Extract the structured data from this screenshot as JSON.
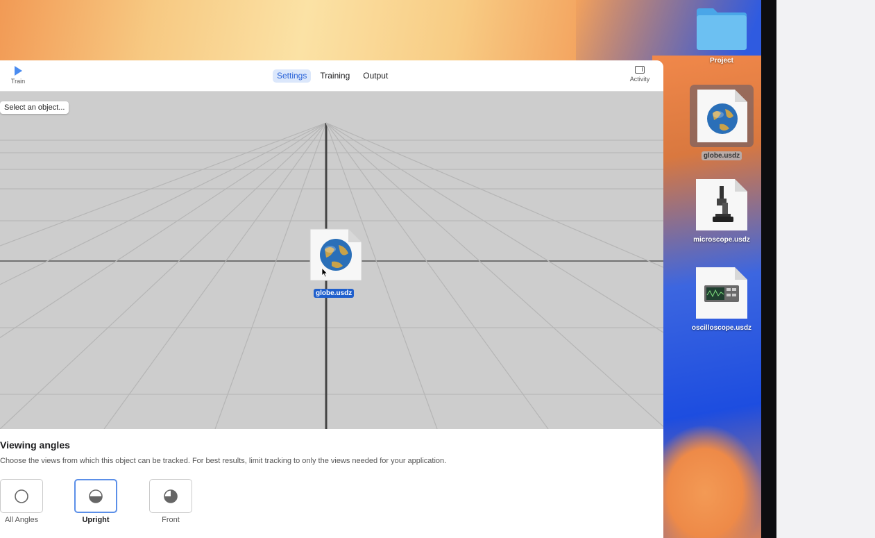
{
  "toolbar": {
    "train_label": "Train",
    "activity_label": "Activity",
    "tabs": [
      {
        "label": "Settings",
        "active": true
      },
      {
        "label": "Training",
        "active": false
      },
      {
        "label": "Output",
        "active": false
      }
    ]
  },
  "viewport": {
    "select_object_label": "Select an object...",
    "dragged_file_label": "globe.usdz"
  },
  "angles": {
    "title": "Viewing angles",
    "description": "Choose the views from which this object can be tracked. For best results, limit tracking to only the views needed for your application.",
    "options": [
      {
        "label": "All Angles",
        "selected": false,
        "icon": "circle-empty-icon"
      },
      {
        "label": "Upright",
        "selected": true,
        "icon": "circle-half-bottom-icon"
      },
      {
        "label": "Front",
        "selected": false,
        "icon": "circle-quarter-icon"
      }
    ]
  },
  "desktop": {
    "items": [
      {
        "label": "Project",
        "icon": "folder-icon"
      },
      {
        "label": "globe.usdz",
        "icon": "globe-file-icon",
        "selected": true
      },
      {
        "label": "microscope.usdz",
        "icon": "microscope-file-icon"
      },
      {
        "label": "oscilloscope.usdz",
        "icon": "oscilloscope-file-icon"
      }
    ]
  },
  "colors": {
    "accent": "#2a63d8",
    "selected_tab_bg": "#dbe7fb",
    "drag_label_bg": "#1f5fcc"
  }
}
